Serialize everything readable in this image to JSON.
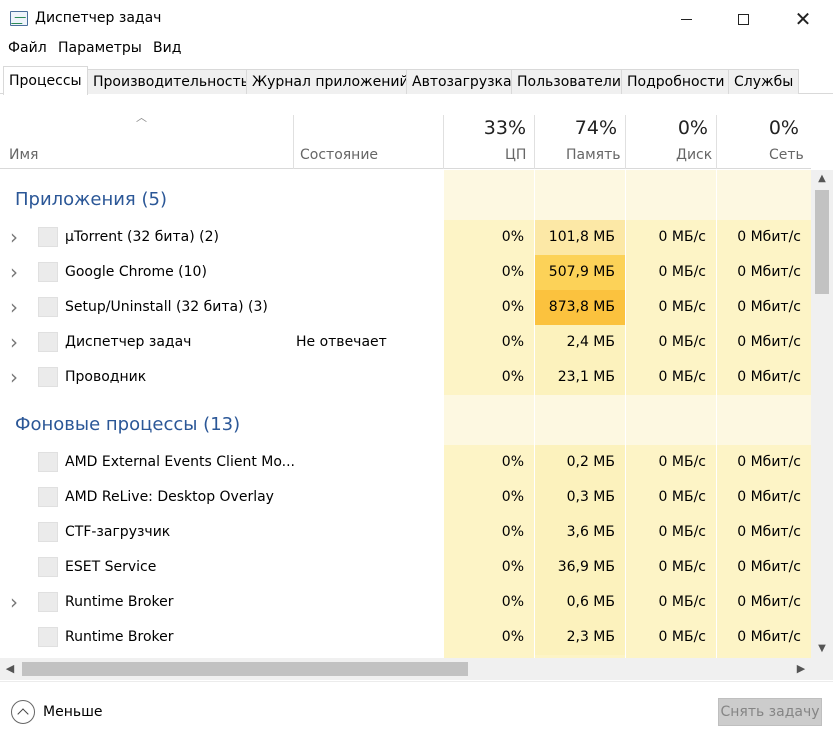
{
  "window": {
    "title": "Диспетчер задач",
    "close_glyph": "✕"
  },
  "menu": [
    "Файл",
    "Параметры",
    "Вид"
  ],
  "tabs": [
    "Процессы",
    "Производительность",
    "Журнал приложений",
    "Автозагрузка",
    "Пользователи",
    "Подробности",
    "Службы"
  ],
  "active_tab": "Процессы",
  "columns": {
    "name": "Имя",
    "status": "Состояние",
    "cpu": {
      "label": "ЦП",
      "total": "33%"
    },
    "memory": {
      "label": "Память",
      "total": "74%"
    },
    "disk": {
      "label": "Диск",
      "total": "0%"
    },
    "network": {
      "label": "Сеть",
      "total": "0%"
    }
  },
  "groups": [
    {
      "title": "Приложения (5)",
      "processes": [
        {
          "name": "µTorrent (32 бита) (2)",
          "status": "",
          "cpu": "0%",
          "memory": "101,8 МБ",
          "disk": "0 МБ/с",
          "network": "0 Мбит/с",
          "expandable": true,
          "mem_heat": "#fce8a6"
        },
        {
          "name": "Google Chrome (10)",
          "status": "",
          "cpu": "0%",
          "memory": "507,9 МБ",
          "disk": "0 МБ/с",
          "network": "0 Мбит/с",
          "expandable": true,
          "mem_heat": "#fcd258"
        },
        {
          "name": "Setup/Uninstall (32 бита) (3)",
          "status": "",
          "cpu": "0%",
          "memory": "873,8 МБ",
          "disk": "0 МБ/с",
          "network": "0 Мбит/с",
          "expandable": true,
          "mem_heat": "#fbc23e"
        },
        {
          "name": "Диспетчер задач",
          "status": "Не отвечает",
          "cpu": "0%",
          "memory": "2,4 МБ",
          "disk": "0 МБ/с",
          "network": "0 Мбит/с",
          "expandable": true,
          "mem_heat": "#fcf2bd"
        },
        {
          "name": "Проводник",
          "status": "",
          "cpu": "0%",
          "memory": "23,1 МБ",
          "disk": "0 МБ/с",
          "network": "0 Мбит/с",
          "expandable": true,
          "mem_heat": "#fcf2bd"
        }
      ]
    },
    {
      "title": "Фоновые процессы (13)",
      "processes": [
        {
          "name": "AMD External Events Client Mo...",
          "status": "",
          "cpu": "0%",
          "memory": "0,2 МБ",
          "disk": "0 МБ/с",
          "network": "0 Мбит/с",
          "expandable": false,
          "mem_heat": "#fcf2bd"
        },
        {
          "name": "AMD ReLive: Desktop Overlay",
          "status": "",
          "cpu": "0%",
          "memory": "0,3 МБ",
          "disk": "0 МБ/с",
          "network": "0 Мбит/с",
          "expandable": false,
          "mem_heat": "#fcf2bd"
        },
        {
          "name": "CTF-загрузчик",
          "status": "",
          "cpu": "0%",
          "memory": "3,6 МБ",
          "disk": "0 МБ/с",
          "network": "0 Мбит/с",
          "expandable": false,
          "mem_heat": "#fcf2bd"
        },
        {
          "name": "ESET Service",
          "status": "",
          "cpu": "0%",
          "memory": "36,9 МБ",
          "disk": "0 МБ/с",
          "network": "0 Мбит/с",
          "expandable": false,
          "mem_heat": "#fcf2bd"
        },
        {
          "name": "Runtime Broker",
          "status": "",
          "cpu": "0%",
          "memory": "0,6 МБ",
          "disk": "0 МБ/с",
          "network": "0 Мбит/с",
          "expandable": true,
          "mem_heat": "#fcf2bd"
        },
        {
          "name": "Runtime Broker",
          "status": "",
          "cpu": "0%",
          "memory": "2,3 МБ",
          "disk": "0 МБ/с",
          "network": "0 Мбит/с",
          "expandable": false,
          "mem_heat": "#fcf2bd"
        }
      ]
    }
  ],
  "colors": {
    "heat_light": "#fdf4c6",
    "heat_group": "#fdf8e1",
    "accent": "#2b5797"
  },
  "footer": {
    "less_label": "Меньше",
    "end_task_label": "Снять задачу"
  },
  "icons": {
    "expander": "chevron-right-icon",
    "sort": "sort-up-icon",
    "less": "chevron-up-circle-icon"
  }
}
